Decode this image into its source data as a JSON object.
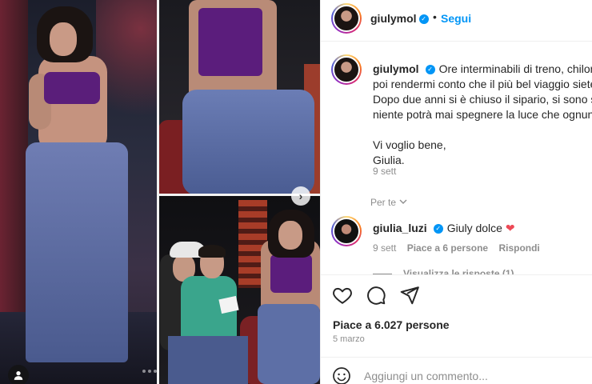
{
  "post": {
    "author": "giulymol",
    "follow_label": "Segui",
    "separator": "•",
    "verified_badge": "✓"
  },
  "caption": {
    "username": "giulymol",
    "lines": [
      "Ore interminabili di treno, chilom",
      "poi rendermi conto che il più bel viaggio siete",
      "Dopo due anni si è chiuso il sipario, si sono sp",
      "niente potrà mai spegnere la luce che ognuno"
    ],
    "sign_lines": [
      "Vi voglio bene,",
      "Giulia."
    ],
    "time": "9 sett"
  },
  "translate_label": "Per te",
  "comment": {
    "username": "giulia_luzi",
    "text": "Giuly dolce",
    "heart": "❤",
    "time": "9 sett",
    "likes": "Piace a 6 persone",
    "reply": "Rispondi",
    "view_replies": "Visualizza le risposte (1)"
  },
  "likes_text": "Piace a 6.027 persone",
  "date_text": "5 marzo",
  "comment_input": {
    "placeholder": "Aggiungi un commento..."
  },
  "media": {
    "next_glyph": "›"
  },
  "icons": [
    "heart-icon",
    "comment-icon",
    "share-icon",
    "emoji-icon",
    "user-tag-icon",
    "chevron-right-icon",
    "chevron-down-icon"
  ],
  "colors": {
    "accent": "#0095f6",
    "like_red": "#ed4956",
    "meta_gray": "#8e8e8e"
  }
}
